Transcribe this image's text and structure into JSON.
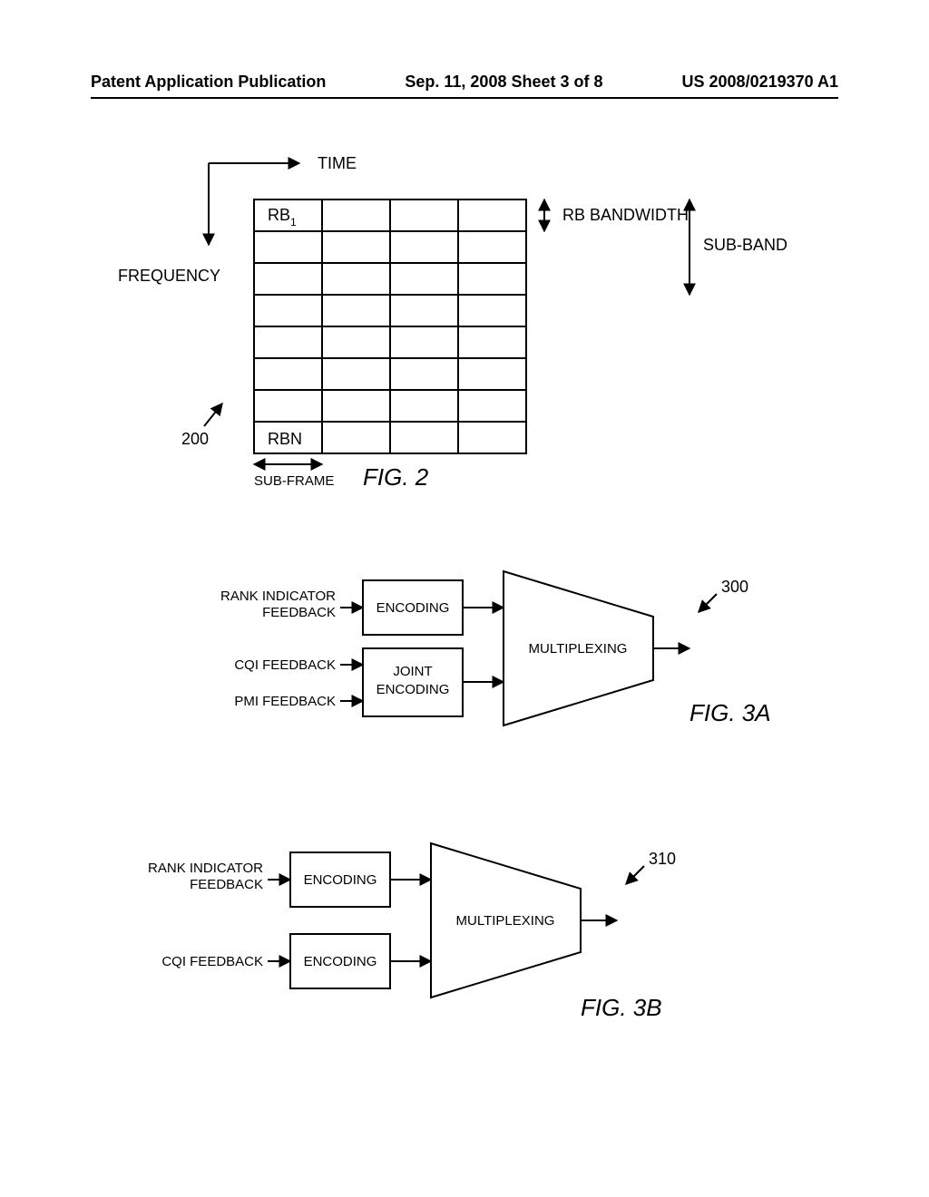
{
  "header": {
    "left": "Patent Application Publication",
    "mid": "Sep. 11, 2008  Sheet 3 of 8",
    "right": "US 2008/0219370 A1"
  },
  "fig2": {
    "axis_time": "TIME",
    "axis_freq": "FREQUENCY",
    "rb1": "RB",
    "rb1_sub": "1",
    "rbn": "RBN",
    "rb_bw": "RB BANDWIDTH",
    "sub_band": "SUB-BAND",
    "sub_frame": "SUB-FRAME",
    "ref": "200",
    "caption": "FIG. 2"
  },
  "fig3a": {
    "rank1": "RANK INDICATOR",
    "rank2": "FEEDBACK",
    "cqi": "CQI FEEDBACK",
    "pmi": "PMI FEEDBACK",
    "enc": "ENCODING",
    "joint1": "JOINT",
    "joint2": "ENCODING",
    "mux": "MULTIPLEXING",
    "ref": "300",
    "caption": "FIG. 3A"
  },
  "fig3b": {
    "rank1": "RANK INDICATOR",
    "rank2": "FEEDBACK",
    "cqi": "CQI FEEDBACK",
    "enc": "ENCODING",
    "mux": "MULTIPLEXING",
    "ref": "310",
    "caption": "FIG. 3B"
  }
}
